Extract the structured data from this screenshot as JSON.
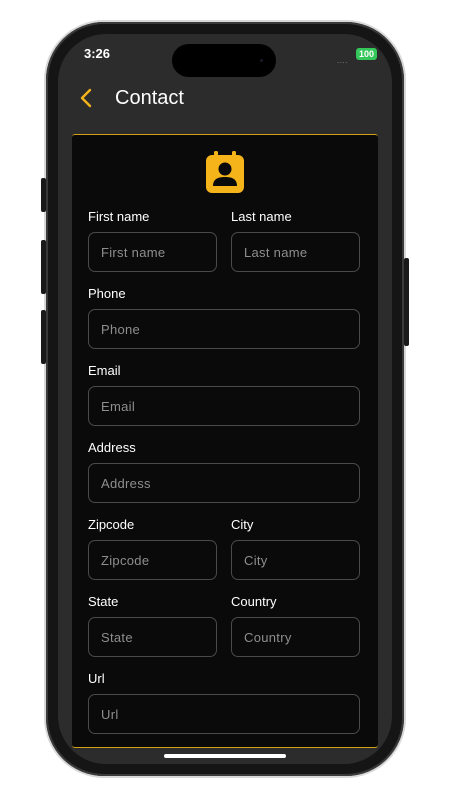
{
  "status_bar": {
    "time": "3:26",
    "signal": "....",
    "battery": "100"
  },
  "nav": {
    "title": "Contact",
    "back_icon": "chevron-left-icon"
  },
  "colors": {
    "accent": "#f4b41a",
    "background": "#2c2c2c",
    "card": "#0a0a0a",
    "battery": "#34c759"
  },
  "form": {
    "header_icon": "contact-card-icon",
    "first_name": {
      "label": "First name",
      "placeholder": "First name",
      "value": ""
    },
    "last_name": {
      "label": "Last name",
      "placeholder": "Last name",
      "value": ""
    },
    "phone": {
      "label": "Phone",
      "placeholder": "Phone",
      "value": ""
    },
    "email": {
      "label": "Email",
      "placeholder": "Email",
      "value": ""
    },
    "address": {
      "label": "Address",
      "placeholder": "Address",
      "value": ""
    },
    "zipcode": {
      "label": "Zipcode",
      "placeholder": "Zipcode",
      "value": ""
    },
    "city": {
      "label": "City",
      "placeholder": "City",
      "value": ""
    },
    "state": {
      "label": "State",
      "placeholder": "State",
      "value": ""
    },
    "country": {
      "label": "Country",
      "placeholder": "Country",
      "value": ""
    },
    "url": {
      "label": "Url",
      "placeholder": "Url",
      "value": ""
    }
  }
}
